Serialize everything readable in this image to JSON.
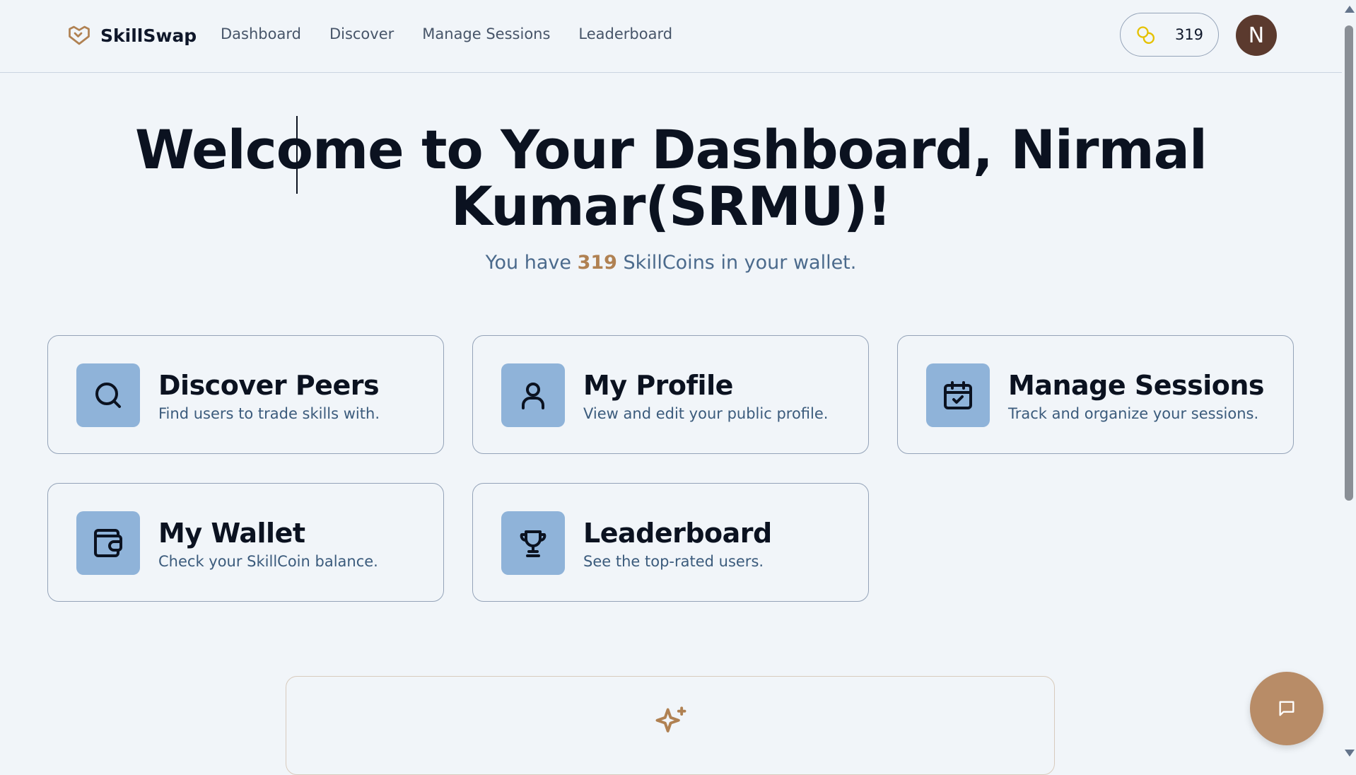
{
  "header": {
    "brand": "SkillSwap",
    "nav": [
      "Dashboard",
      "Discover",
      "Manage Sessions",
      "Leaderboard"
    ],
    "coins": "319",
    "avatar_initial": "N"
  },
  "hero": {
    "title": "Welcome to Your Dashboard, Nirmal Kumar(SRMU)!",
    "sub_prefix": "You have ",
    "sub_coins": "319",
    "sub_suffix": " SkillCoins in your wallet."
  },
  "cards": [
    {
      "title": "Discover Peers",
      "desc": "Find users to trade skills with.",
      "icon": "search-icon"
    },
    {
      "title": "My Profile",
      "desc": "View and edit your public profile.",
      "icon": "user-icon"
    },
    {
      "title": "Manage Sessions",
      "desc": "Track and organize your sessions.",
      "icon": "calendar-check-icon"
    },
    {
      "title": "My Wallet",
      "desc": "Check your SkillCoin balance.",
      "icon": "wallet-icon"
    },
    {
      "title": "Leaderboard",
      "desc": "See the top-rated users.",
      "icon": "trophy-icon"
    }
  ],
  "colors": {
    "background": "#f1f5f9",
    "accent": "#b08152",
    "icon_tile": "#8fb3d9",
    "avatar": "#5b3a2e",
    "chat_button": "#b88c67"
  }
}
